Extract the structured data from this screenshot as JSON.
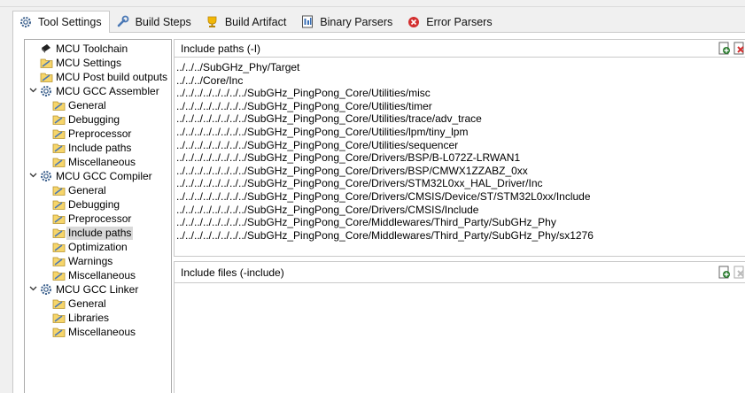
{
  "tabs": [
    {
      "label": "Tool Settings",
      "icon": "gear-icon",
      "active": true
    },
    {
      "label": "Build Steps",
      "icon": "wrench-icon",
      "active": false
    },
    {
      "label": "Build Artifact",
      "icon": "trophy-icon",
      "active": false
    },
    {
      "label": "Binary Parsers",
      "icon": "binary-icon",
      "active": false
    },
    {
      "label": "Error Parsers",
      "icon": "error-icon",
      "active": false
    }
  ],
  "tree": {
    "toolchain": "MCU Toolchain",
    "settings": "MCU Settings",
    "post_build": "MCU Post build outputs",
    "assembler": {
      "label": "MCU GCC Assembler",
      "children": [
        "General",
        "Debugging",
        "Preprocessor",
        "Include paths",
        "Miscellaneous"
      ]
    },
    "compiler": {
      "label": "MCU GCC Compiler",
      "children": [
        "General",
        "Debugging",
        "Preprocessor",
        "Include paths",
        "Optimization",
        "Warnings",
        "Miscellaneous"
      ]
    },
    "linker": {
      "label": "MCU GCC Linker",
      "children": [
        "General",
        "Libraries",
        "Miscellaneous"
      ]
    },
    "selected": "compiler.Include paths"
  },
  "include_paths": {
    "title": "Include paths (-I)",
    "items": [
      "../../../SubGHz_Phy/Target",
      "../../../Core/Inc",
      "../../../../../../../../SubGHz_PingPong_Core/Utilities/misc",
      "../../../../../../../../SubGHz_PingPong_Core/Utilities/timer",
      "../../../../../../../../SubGHz_PingPong_Core/Utilities/trace/adv_trace",
      "../../../../../../../../SubGHz_PingPong_Core/Utilities/lpm/tiny_lpm",
      "../../../../../../../../SubGHz_PingPong_Core/Utilities/sequencer",
      "../../../../../../../../SubGHz_PingPong_Core/Drivers/BSP/B-L072Z-LRWAN1",
      "../../../../../../../../SubGHz_PingPong_Core/Drivers/BSP/CMWX1ZZABZ_0xx",
      "../../../../../../../../SubGHz_PingPong_Core/Drivers/STM32L0xx_HAL_Driver/Inc",
      "../../../../../../../../SubGHz_PingPong_Core/Drivers/CMSIS/Device/ST/STM32L0xx/Include",
      "../../../../../../../../SubGHz_PingPong_Core/Drivers/CMSIS/Include",
      "../../../../../../../../SubGHz_PingPong_Core/Middlewares/Third_Party/SubGHz_Phy",
      "../../../../../../../../SubGHz_PingPong_Core/Middlewares/Third_Party/SubGHz_Phy/sx1276"
    ]
  },
  "include_files": {
    "title": "Include files (-include)",
    "items": []
  },
  "colors": {
    "accent": "#2e7d32",
    "error": "#d32f2f",
    "selection": "#d9d9d9"
  }
}
